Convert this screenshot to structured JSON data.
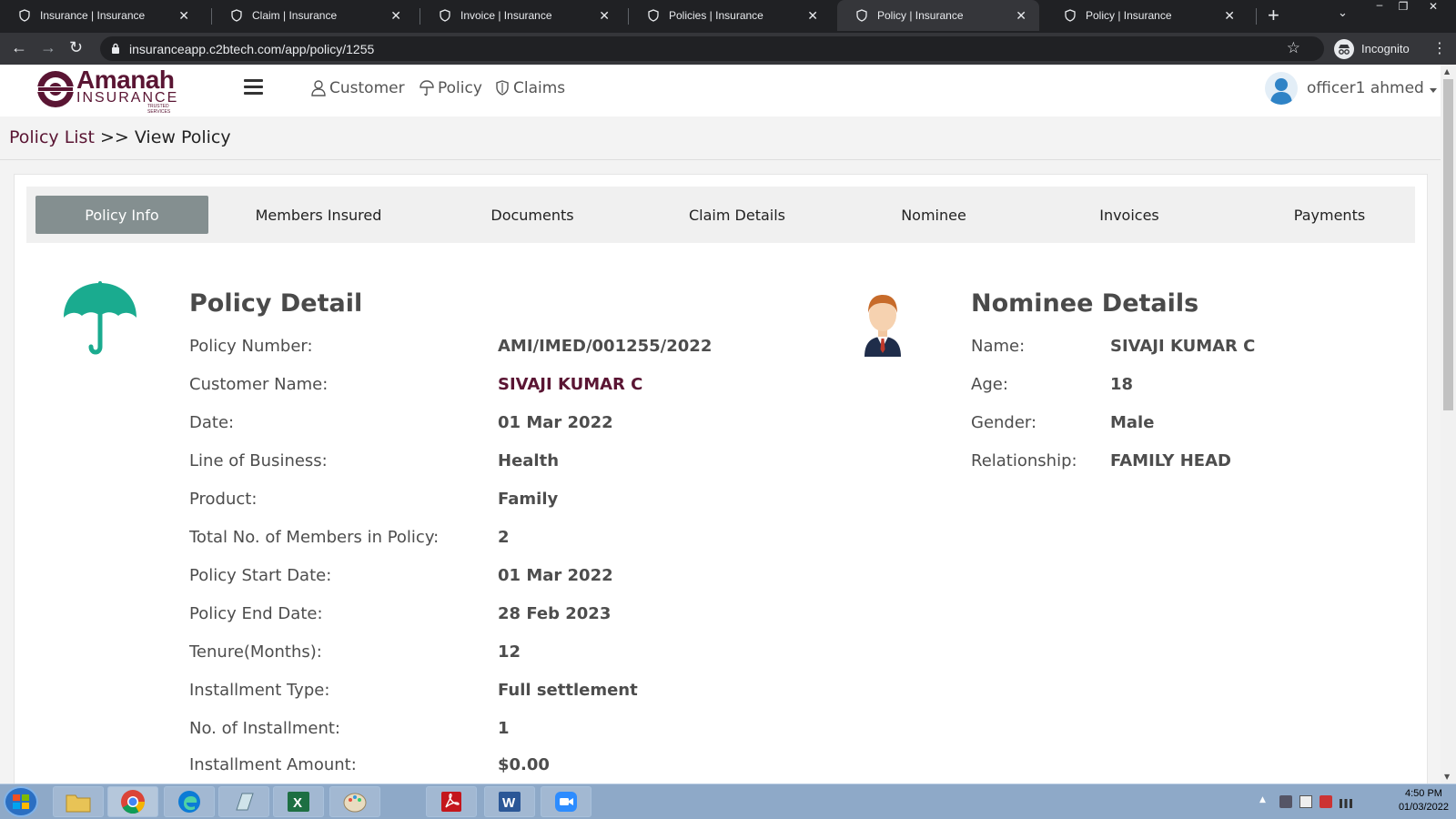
{
  "browser": {
    "tabs": [
      {
        "title": "Insurance | Insurance",
        "active": false
      },
      {
        "title": "Claim | Insurance",
        "active": false
      },
      {
        "title": "Invoice | Insurance",
        "active": false
      },
      {
        "title": "Policies | Insurance",
        "active": false
      },
      {
        "title": "Policy | Insurance",
        "active": true
      },
      {
        "title": "Policy | Insurance",
        "active": false
      }
    ],
    "url": "insuranceapp.c2btech.com/app/policy/1255",
    "incognito_label": "Incognito"
  },
  "header": {
    "logo_main": "Amanah",
    "logo_sub": "INSURANCE",
    "logo_tag": "TRUSTED SERVICES",
    "nav": [
      {
        "label": "Customer",
        "icon": "user-icon"
      },
      {
        "label": "Policy",
        "icon": "umbrella-icon"
      },
      {
        "label": "Claims",
        "icon": "shield-icon"
      }
    ],
    "user_name": "officer1 ahmed"
  },
  "breadcrumb": {
    "link": "Policy List",
    "separator": ">>",
    "current": "View Policy"
  },
  "tabs": [
    {
      "label": "Policy Info",
      "active": true
    },
    {
      "label": "Members Insured",
      "active": false
    },
    {
      "label": "Documents",
      "active": false
    },
    {
      "label": "Claim Details",
      "active": false
    },
    {
      "label": "Nominee",
      "active": false
    },
    {
      "label": "Invoices",
      "active": false
    },
    {
      "label": "Payments",
      "active": false
    }
  ],
  "policy": {
    "title": "Policy Detail",
    "fields": [
      {
        "label": "Policy Number:",
        "value": "AMI/IMED/001255/2022"
      },
      {
        "label": "Customer Name:",
        "value": "SIVAJI KUMAR C"
      },
      {
        "label": "Date:",
        "value": "01 Mar 2022"
      },
      {
        "label": "Line of Business:",
        "value": "Health"
      },
      {
        "label": "Product:",
        "value": "Family"
      },
      {
        "label": "Total No. of Members in Policy:",
        "value": "2"
      },
      {
        "label": "Policy Start Date:",
        "value": "01 Mar 2022"
      },
      {
        "label": "Policy End Date:",
        "value": "28 Feb 2023"
      },
      {
        "label": "Tenure(Months):",
        "value": "12"
      },
      {
        "label": "Installment Type:",
        "value": "Full settlement"
      },
      {
        "label": "No. of Installment:",
        "value": "1"
      },
      {
        "label": "Installment Amount:",
        "value": "$0.00"
      }
    ]
  },
  "nominee": {
    "title": "Nominee Details",
    "fields": [
      {
        "label": "Name:",
        "value": "SIVAJI KUMAR C"
      },
      {
        "label": "Age:",
        "value": "18"
      },
      {
        "label": "Gender:",
        "value": "Male"
      },
      {
        "label": "Relationship:",
        "value": "FAMILY HEAD"
      }
    ]
  },
  "taskbar": {
    "time": "4:50 PM",
    "date": "01/03/2022"
  },
  "colors": {
    "brand": "#5a1533",
    "accent_teal": "#1aab8f",
    "active_tab": "#848f90"
  }
}
